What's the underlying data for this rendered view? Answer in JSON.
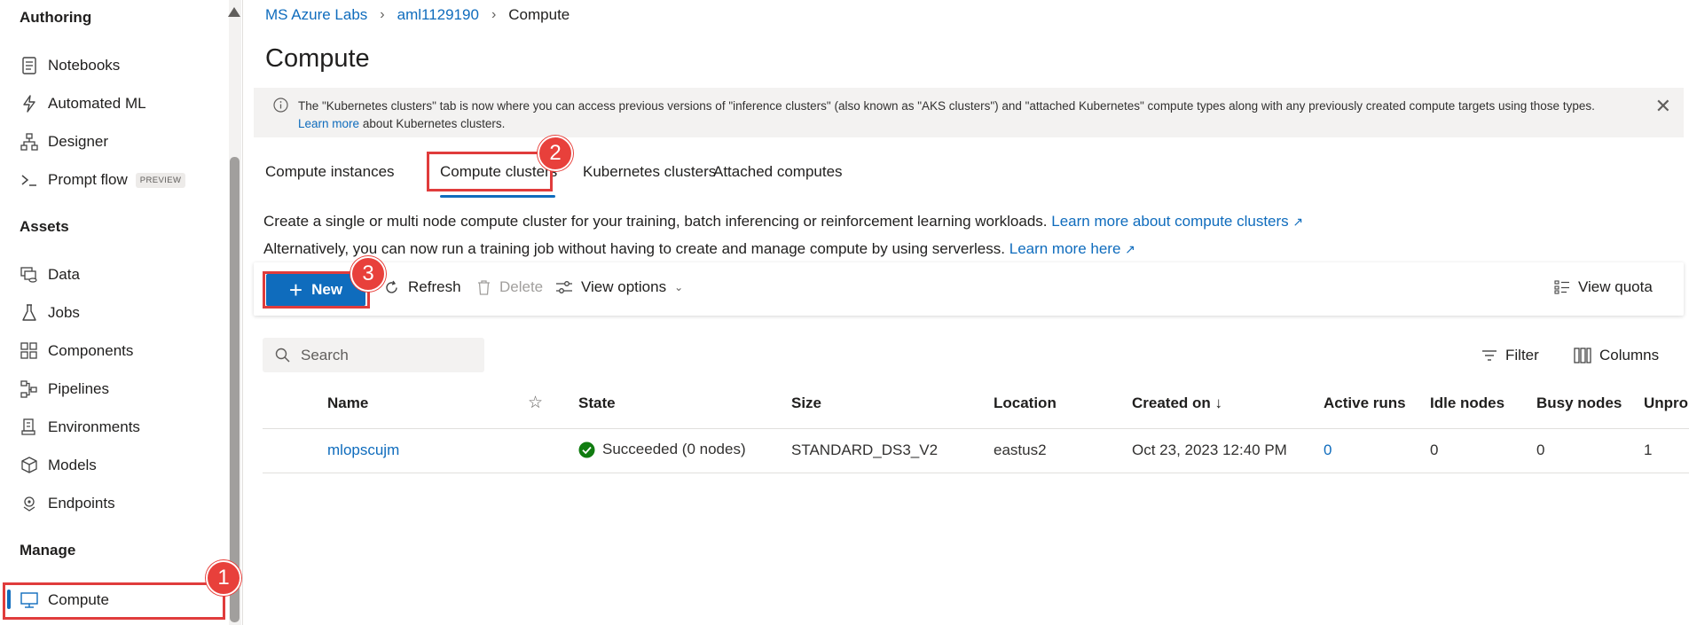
{
  "sidebar": {
    "sections": {
      "authoring": "Authoring",
      "assets": "Assets",
      "manage": "Manage"
    },
    "items": [
      {
        "label": "Notebooks",
        "icon": "notebook-icon"
      },
      {
        "label": "Automated ML",
        "icon": "automl-icon"
      },
      {
        "label": "Designer",
        "icon": "designer-icon"
      },
      {
        "label": "Prompt flow",
        "icon": "prompt-icon",
        "badge": "PREVIEW"
      },
      {
        "label": "Data",
        "icon": "data-icon"
      },
      {
        "label": "Jobs",
        "icon": "flask-icon"
      },
      {
        "label": "Components",
        "icon": "components-icon"
      },
      {
        "label": "Pipelines",
        "icon": "pipelines-icon"
      },
      {
        "label": "Environments",
        "icon": "environments-icon"
      },
      {
        "label": "Models",
        "icon": "cube-icon"
      },
      {
        "label": "Endpoints",
        "icon": "endpoints-icon"
      },
      {
        "label": "Compute",
        "icon": "computer-icon",
        "active": true
      }
    ]
  },
  "callouts": [
    "1",
    "2",
    "3"
  ],
  "breadcrumb": {
    "workspace_group": "MS Azure Labs",
    "workspace": "aml1129190",
    "current": "Compute"
  },
  "page_title": "Compute",
  "banner": {
    "text_before": "The \"Kubernetes clusters\" tab is now where you can access previous versions of \"inference clusters\" (also known as \"AKS clusters\") and \"attached Kubernetes\" compute types along with any previously created compute targets using those types.",
    "link": "Learn more",
    "text_after": "about Kubernetes clusters."
  },
  "tabs": [
    {
      "label": "Compute instances"
    },
    {
      "label": "Compute clusters",
      "selected": true
    },
    {
      "label": "Kubernetes clusters"
    },
    {
      "label": "Attached computes"
    }
  ],
  "description": {
    "line1": "Create a single or multi node compute cluster for your training, batch inferencing or reinforcement learning workloads.",
    "line1_link": "Learn more about compute clusters",
    "line2": "Alternatively, you can now run a training job without having to create and manage compute by using serverless.",
    "line2_link": "Learn more here"
  },
  "toolbar": {
    "new": "New",
    "refresh": "Refresh",
    "delete": "Delete",
    "view_options": "View options",
    "view_quota": "View quota"
  },
  "search": {
    "placeholder": "Search",
    "value": ""
  },
  "list_tools": {
    "filter": "Filter",
    "columns": "Columns"
  },
  "table": {
    "headers": {
      "name": "Name",
      "state": "State",
      "size": "Size",
      "location": "Location",
      "created_on": "Created on ↓",
      "active_runs": "Active runs",
      "idle_nodes": "Idle nodes",
      "busy_nodes": "Busy nodes",
      "unprovisioned": "Unpro"
    },
    "rows": [
      {
        "name": "mlopscujm",
        "state": "Succeeded (0 nodes)",
        "size": "STANDARD_DS3_V2",
        "location": "eastus2",
        "created_on": "Oct 23, 2023 12:40 PM",
        "active_runs": "0",
        "idle_nodes": "0",
        "busy_nodes": "0",
        "unprovisioned": "1"
      }
    ]
  },
  "colors": {
    "accent": "#0f6cbd",
    "highlight": "#e03c3c",
    "success": "#107c10"
  }
}
